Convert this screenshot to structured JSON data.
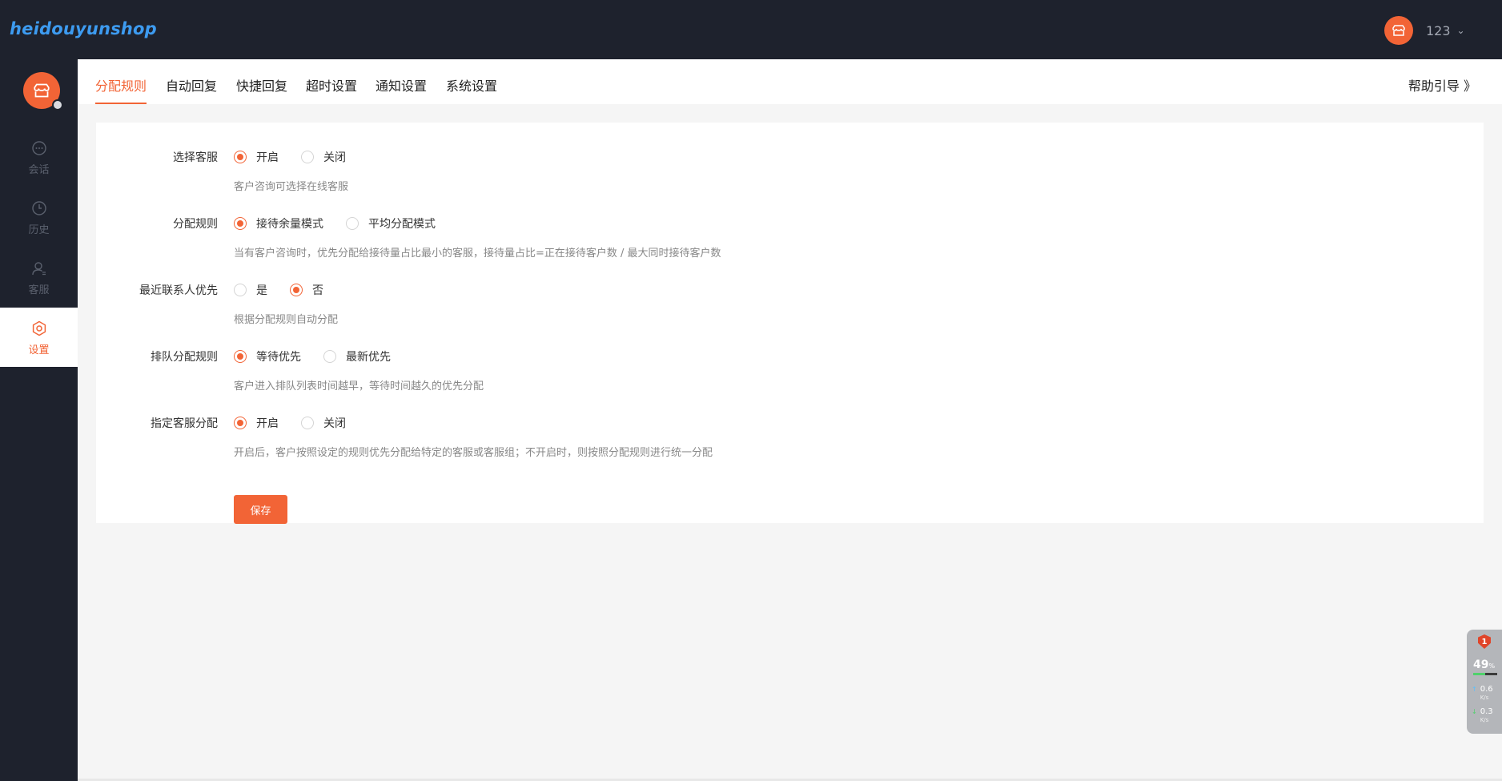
{
  "header": {
    "logo": "heidouyunshop",
    "user_name": "123"
  },
  "sidebar": {
    "items": [
      {
        "label": "会话",
        "icon": "chat-icon"
      },
      {
        "label": "历史",
        "icon": "clock-icon"
      },
      {
        "label": "客服",
        "icon": "user-icon"
      },
      {
        "label": "设置",
        "icon": "settings-icon",
        "active": true
      }
    ]
  },
  "tabs": [
    {
      "label": "分配规则",
      "active": true
    },
    {
      "label": "自动回复"
    },
    {
      "label": "快捷回复"
    },
    {
      "label": "超时设置"
    },
    {
      "label": "通知设置"
    },
    {
      "label": "系统设置"
    }
  ],
  "help_link": "帮助引导 》",
  "form": {
    "rows": [
      {
        "label": "选择客服",
        "options": [
          "开启",
          "关闭"
        ],
        "selected": 0,
        "hint": "客户咨询可选择在线客服"
      },
      {
        "label": "分配规则",
        "options": [
          "接待余量模式",
          "平均分配模式"
        ],
        "selected": 0,
        "hint": "当有客户咨询时，优先分配给接待量占比最小的客服，接待量占比=正在接待客户数 / 最大同时接待客户数"
      },
      {
        "label": "最近联系人优先",
        "options": [
          "是",
          "否"
        ],
        "selected": 1,
        "hint": "根据分配规则自动分配"
      },
      {
        "label": "排队分配规则",
        "options": [
          "等待优先",
          "最新优先"
        ],
        "selected": 0,
        "hint": "客户进入排队列表时间越早，等待时间越久的优先分配"
      },
      {
        "label": "指定客服分配",
        "options": [
          "开启",
          "关闭"
        ],
        "selected": 0,
        "hint": "开启后，客户按照设定的规则优先分配给特定的客服或客服组；不开启时，则按照分配规则进行统一分配"
      }
    ],
    "save_label": "保存"
  },
  "system_widget": {
    "badge": "1",
    "percent": "49",
    "percent_unit": "%",
    "percent_value": 0.49,
    "up_speed": "0.6",
    "down_speed": "0.3",
    "speed_unit": "K/s"
  },
  "colors": {
    "accent": "#f26436",
    "sidebar_bg": "#1e222d",
    "logo": "#3d9bf0"
  }
}
